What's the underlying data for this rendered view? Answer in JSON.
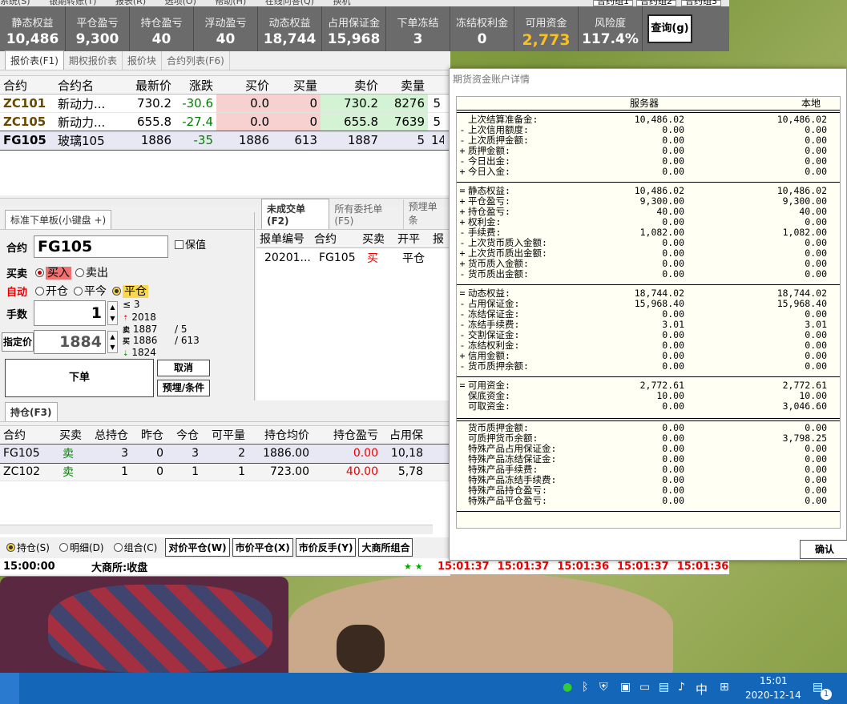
{
  "menu": {
    "items": [
      "系统(S)",
      "银期转账(T)",
      "报表(R)",
      "选项(O)",
      "帮助(H)",
      "在线问答(Q)",
      "换机"
    ],
    "groups": [
      "合约组1",
      "合约组2",
      "合约组3"
    ]
  },
  "summary": {
    "items": [
      {
        "label": "静态权益",
        "value": "10,486"
      },
      {
        "label": "平仓盈亏",
        "value": "9,300"
      },
      {
        "label": "持仓盈亏",
        "value": "40"
      },
      {
        "label": "浮动盈亏",
        "value": "40"
      },
      {
        "label": "动态权益",
        "value": "18,744"
      },
      {
        "label": "占用保证金",
        "value": "15,968"
      },
      {
        "label": "下单冻结",
        "value": "3"
      },
      {
        "label": "冻结权利金",
        "value": "0"
      },
      {
        "label": "可用资金",
        "value": "2,773"
      },
      {
        "label": "风险度",
        "value": "117.4%"
      }
    ],
    "query_label": "查询(g)"
  },
  "quote_tabs": [
    "报价表(F1)",
    "期权报价表",
    "报价块",
    "合约列表(F6)"
  ],
  "quote_table": {
    "headers": [
      "合约",
      "合约名",
      "最新价",
      "涨跌",
      "买价",
      "买量",
      "卖价",
      "卖量"
    ],
    "rows": [
      {
        "code": "ZC101",
        "name": "新动力...",
        "last": "730.2",
        "chg": "-30.6",
        "bid": "0.0",
        "bidv": "0",
        "ask": "730.2",
        "askv": "8276",
        "extra": "5"
      },
      {
        "code": "ZC105",
        "name": "新动力...",
        "last": "655.8",
        "chg": "-27.4",
        "bid": "0.0",
        "bidv": "0",
        "ask": "655.8",
        "askv": "7639",
        "extra": "5"
      },
      {
        "code": "FG105",
        "name": "玻璃105",
        "last": "1886",
        "chg": "-35",
        "bid": "1886",
        "bidv": "613",
        "ask": "1887",
        "askv": "5",
        "extra": "14"
      }
    ]
  },
  "order_panel": {
    "tab": "标准下单板(小键盘 +)",
    "contract_label": "合约",
    "contract_value": "FG105",
    "guarantee_label": "保值",
    "side_label": "买卖",
    "buy": "买入",
    "sell": "卖出",
    "auto_label": "自动",
    "open": "开仓",
    "close_today": "平今",
    "close": "平仓",
    "qty_label": "手数",
    "qty": "1",
    "qty_le": "≤",
    "qty_max": "3",
    "price_label": "指定价",
    "price": "1884",
    "limit_up": "2018",
    "sell_price": "1887",
    "sell_vol": "5",
    "buy_price": "1886",
    "buy_vol": "613",
    "limit_down": "1824",
    "submit": "下单",
    "cancel": "取消",
    "preset": "预埋/条件",
    "sell_tag": "卖",
    "buy_tag": "买"
  },
  "pending": {
    "tabs": [
      "未成交单(F2)",
      "所有委托单(F5)",
      "预埋单条"
    ],
    "headers": [
      "报单编号",
      "合约",
      "买卖",
      "开平",
      "报"
    ],
    "rows": [
      {
        "id": "20201...",
        "code": "FG105",
        "side": "买",
        "oc": "平仓"
      }
    ]
  },
  "positions": {
    "tab": "持仓(F3)",
    "headers": [
      "合约",
      "买卖",
      "总持仓",
      "昨仓",
      "今仓",
      "可平量",
      "持仓均价",
      "持仓盈亏",
      "占用保"
    ],
    "rows": [
      {
        "code": "FG105",
        "side": "卖",
        "total": "3",
        "yd": "0",
        "td": "3",
        "avail": "2",
        "avg": "1886.00",
        "pnl": "0.00",
        "margin": "10,18"
      },
      {
        "code": "ZC102",
        "side": "卖",
        "total": "1",
        "yd": "0",
        "td": "1",
        "avail": "1",
        "avg": "723.00",
        "pnl": "40.00",
        "margin": "5,78"
      }
    ],
    "modes": [
      "持仓(S)",
      "明细(D)",
      "组合(C)"
    ],
    "buttons": [
      "对价平仓(W)",
      "市价平仓(X)",
      "市价反手(Y)",
      "大商所组合"
    ]
  },
  "status": {
    "time": "15:00:00",
    "exchange": "大商所:收盘",
    "stars": "★ ★",
    "clocks": [
      "15:01:37",
      "15:01:37",
      "15:01:36",
      "15:01:37",
      "15:01:36"
    ]
  },
  "dialog": {
    "title": "期货资金账户详情",
    "col_server": "服务器",
    "col_local": "本地",
    "groups": [
      [
        {
          "s": "",
          "n": "上次结算准备金:",
          "v1": "10,486.02",
          "v2": "10,486.02"
        },
        {
          "s": "-",
          "n": "上次信用额度:",
          "v1": "0.00",
          "v2": "0.00"
        },
        {
          "s": "-",
          "n": "上次质押金额:",
          "v1": "0.00",
          "v2": "0.00"
        },
        {
          "s": "+",
          "n": "质押金额:",
          "v1": "0.00",
          "v2": "0.00"
        },
        {
          "s": "-",
          "n": "今日出金:",
          "v1": "0.00",
          "v2": "0.00"
        },
        {
          "s": "+",
          "n": "今日入金:",
          "v1": "0.00",
          "v2": "0.00"
        }
      ],
      [
        {
          "s": "=",
          "n": "静态权益:",
          "v1": "10,486.02",
          "v2": "10,486.02"
        },
        {
          "s": "+",
          "n": "平仓盈亏:",
          "v1": "9,300.00",
          "v2": "9,300.00"
        },
        {
          "s": "+",
          "n": "持仓盈亏:",
          "v1": "40.00",
          "v2": "40.00"
        },
        {
          "s": "+",
          "n": "权利金:",
          "v1": "0.00",
          "v2": "0.00"
        },
        {
          "s": "-",
          "n": "手续费:",
          "v1": "1,082.00",
          "v2": "1,082.00"
        },
        {
          "s": "-",
          "n": "上次货币质入金额:",
          "v1": "0.00",
          "v2": "0.00"
        },
        {
          "s": "+",
          "n": "上次货币质出金额:",
          "v1": "0.00",
          "v2": "0.00"
        },
        {
          "s": "+",
          "n": "货币质入金额:",
          "v1": "0.00",
          "v2": "0.00"
        },
        {
          "s": "-",
          "n": "货币质出金额:",
          "v1": "0.00",
          "v2": "0.00"
        }
      ],
      [
        {
          "s": "=",
          "n": "动态权益:",
          "v1": "18,744.02",
          "v2": "18,744.02"
        },
        {
          "s": "-",
          "n": "占用保证金:",
          "v1": "15,968.40",
          "v2": "15,968.40"
        },
        {
          "s": "-",
          "n": "冻结保证金:",
          "v1": "0.00",
          "v2": "0.00"
        },
        {
          "s": "-",
          "n": "冻结手续费:",
          "v1": "3.01",
          "v2": "3.01"
        },
        {
          "s": "-",
          "n": "交割保证金:",
          "v1": "0.00",
          "v2": "0.00"
        },
        {
          "s": "-",
          "n": "冻结权利金:",
          "v1": "0.00",
          "v2": "0.00"
        },
        {
          "s": "+",
          "n": "信用金额:",
          "v1": "0.00",
          "v2": "0.00"
        },
        {
          "s": "-",
          "n": "货币质押余额:",
          "v1": "0.00",
          "v2": "0.00"
        }
      ],
      [
        {
          "s": "=",
          "n": "可用资金:",
          "v1": "2,772.61",
          "v2": "2,772.61"
        },
        {
          "s": "",
          "n": "保底资金:",
          "v1": "10.00",
          "v2": "10.00"
        },
        {
          "s": "",
          "n": "可取资金:",
          "v1": "0.00",
          "v2": "3,046.60"
        }
      ],
      [
        {
          "s": "",
          "n": "货币质押金额:",
          "v1": "0.00",
          "v2": "0.00"
        },
        {
          "s": "",
          "n": "可质押货币余额:",
          "v1": "0.00",
          "v2": "3,798.25"
        },
        {
          "s": "",
          "n": "特殊产品占用保证金:",
          "v1": "0.00",
          "v2": "0.00"
        },
        {
          "s": "",
          "n": "特殊产品冻结保证金:",
          "v1": "0.00",
          "v2": "0.00"
        },
        {
          "s": "",
          "n": "特殊产品手续费:",
          "v1": "0.00",
          "v2": "0.00"
        },
        {
          "s": "",
          "n": "特殊产品冻结手续费:",
          "v1": "0.00",
          "v2": "0.00"
        },
        {
          "s": "",
          "n": "特殊产品持仓盈亏:",
          "v1": "0.00",
          "v2": "0.00"
        },
        {
          "s": "",
          "n": "特殊产品平仓盈亏:",
          "v1": "0.00",
          "v2": "0.00"
        }
      ]
    ],
    "confirm": "确认"
  },
  "taskbar": {
    "ime": "中",
    "time": "15:01",
    "date": "2020-12-14",
    "notif_count": "1"
  },
  "colors": {
    "accent_gold": "#f8c023",
    "header_gray": "#6b6b6b",
    "taskbar": "#1466b8"
  }
}
